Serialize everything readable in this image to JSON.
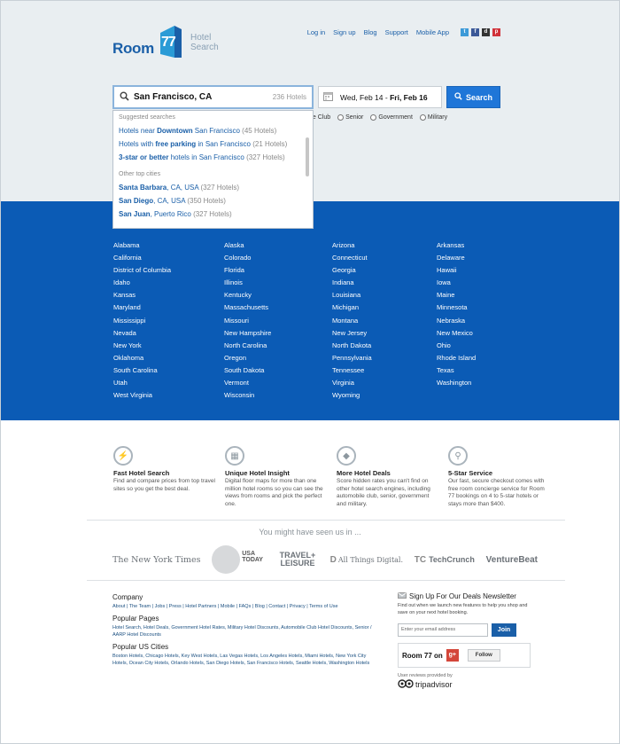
{
  "brand": {
    "word": "Room",
    "digits": "77",
    "sub1": "Hotel",
    "sub2": "Search"
  },
  "topnav": {
    "links": [
      "Log in",
      "Sign up",
      "Blog",
      "Support",
      "Mobile App"
    ],
    "social": [
      {
        "icon": "twitter-icon",
        "glyph": "t",
        "color": "#3c9ad8"
      },
      {
        "icon": "facebook-icon",
        "glyph": "f",
        "color": "#3b5998"
      },
      {
        "icon": "delicious-icon",
        "glyph": "d",
        "color": "#333333"
      },
      {
        "icon": "pinterest-icon",
        "glyph": "p",
        "color": "#d0323a"
      }
    ]
  },
  "search": {
    "value": "San Francisco, CA",
    "count": "236 Hotels",
    "date_from": "Wed, Feb 14",
    "sep": " - ",
    "date_to": "Fri, Feb 16",
    "button": "Search"
  },
  "discounts": [
    "obile Club",
    "Senior",
    "Government",
    "Military"
  ],
  "dropdown": {
    "suggested_header": "Suggested searches",
    "suggested": [
      {
        "pre": "Hotels near ",
        "bold": "Downtown",
        "post": " San Francisco",
        "n": "(45 Hotels)"
      },
      {
        "pre": "Hotels with ",
        "bold": "free parking",
        "post": " in San Francisco",
        "n": "(21 Hotels)"
      },
      {
        "pre": "",
        "bold": "3-star or better",
        "post": " hotels in San Francisco",
        "n": "(327 Hotels)"
      }
    ],
    "cities_header": "Other top cities",
    "cities": [
      {
        "bold": "Santa Barbara",
        "post": ", CA, USA",
        "n": "(327 Hotels)"
      },
      {
        "bold": "San Diego",
        "post": ", CA, USA",
        "n": "(350 Hotels)"
      },
      {
        "bold": "San Juan",
        "post": ", Puerto Rico",
        "n": "(327 Hotels)"
      }
    ]
  },
  "states": [
    [
      "Alabama",
      "California",
      "District of Columbia",
      "Idaho",
      "Kansas",
      "Maryland",
      "Mississippi",
      "Nevada",
      "New York",
      "Oklahoma",
      "South Carolina",
      "Utah",
      "West Virginia"
    ],
    [
      "Alaska",
      "Colorado",
      "Florida",
      "Illinois",
      "Kentucky",
      "Massachusetts",
      "Missouri",
      "New Hampshire",
      "North Carolina",
      "Oregon",
      "South Dakota",
      "Vermont",
      "Wisconsin"
    ],
    [
      "Arizona",
      "Connecticut",
      "Georgia",
      "Indiana",
      "Louisiana",
      "Michigan",
      "Montana",
      "New Jersey",
      "North Dakota",
      "Pennsylvania",
      "Tennessee",
      "Virginia",
      "Wyoming"
    ],
    [
      "Arkansas",
      "Delaware",
      "Hawaii",
      "Iowa",
      "Maine",
      "Minnesota",
      "Nebraska",
      "New Mexico",
      "Ohio",
      "Rhode Island",
      "Texas",
      "Washington"
    ]
  ],
  "features": [
    {
      "icon": "lightning-icon",
      "title": "Fast Hotel Search",
      "text": "Find and compare prices from top travel sites so you get the best deal."
    },
    {
      "icon": "window-icon",
      "title": "Unique Hotel Insight",
      "text": "Digital floor maps for more than one million hotel rooms so you can see the views from rooms and pick the perfect one."
    },
    {
      "icon": "tag-icon",
      "title": "More Hotel Deals",
      "text": "Score hidden rates you can't find on other hotel search engines, including automobile club, senior, government and military."
    },
    {
      "icon": "key-icon",
      "title": "5-Star Service",
      "text": "Our fast, secure checkout comes with free room concierge service for Room 77 bookings on 4 to 5-star hotels or stays more than $400."
    }
  ],
  "seen": "You might have seen us in ...",
  "press": [
    "The New York Times",
    "USA TODAY",
    "TRAVEL+ LEISURE",
    "All Things Digital.",
    "TechCrunch",
    "VentureBeat"
  ],
  "footer": {
    "company_h": "Company",
    "company": "About | The Team | Jobs | Press | Hotel Partners | Mobile | FAQs | Blog | Contact | Privacy | Terms of Use",
    "pages_h": "Popular Pages",
    "pages": "Hotel Search, Hotel Deals, Government Hotel Rates, Military Hotel Discounts, Automobile Club Hotel Discounts, Senior / AARP Hotel Discounts",
    "cities_h": "Popular US Cities",
    "cities": "Boston Hotels, Chicago Hotels, Key West Hotels, Las Vegas Hotels, Los Angeles Hotels, Miami Hotels, New York City Hotels, Ocean City Hotels, Orlando Hotels, San Diego Hotels, San Francisco Hotels, Seattle Hotels, Washington Hotels"
  },
  "newsletter": {
    "title": "Sign Up For Our Deals Newsletter",
    "text": "Find out when we launch new features to help you shop and save on your next hotel booking.",
    "placeholder": "Enter your email address",
    "join": "Join",
    "gplus_name": "Room 77 on",
    "gplus_g": "g+",
    "follow": "Follow",
    "ta_caption": "User reviews provided by",
    "ta_name": "tripadvisor"
  }
}
